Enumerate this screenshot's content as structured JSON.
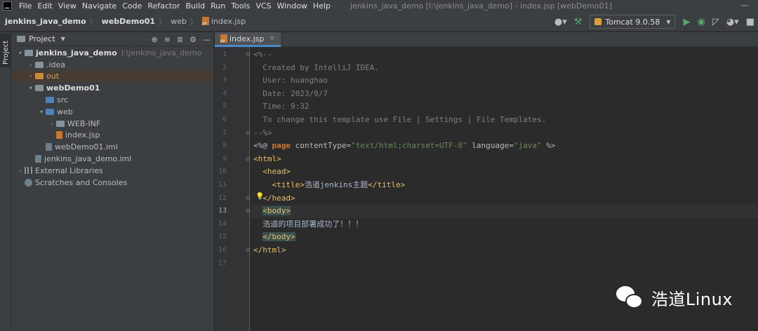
{
  "menubar": {
    "items": [
      "File",
      "Edit",
      "View",
      "Navigate",
      "Code",
      "Refactor",
      "Build",
      "Run",
      "Tools",
      "VCS",
      "Window",
      "Help"
    ],
    "window_title": "jenkins_java_demo [I:\\jenkins_java_demo] - index.jsp [webDemo01]",
    "minimize": "—"
  },
  "navbar": {
    "breadcrumbs": [
      "jenkins_java_demo",
      "webDemo01",
      "web",
      "index.jsp"
    ],
    "run_config": "Tomcat 9.0.58"
  },
  "left_stripe": {
    "label": "Project"
  },
  "project_panel": {
    "title": "Project",
    "tree": [
      {
        "label": "jenkins_java_demo",
        "hint": "I:\\jenkins_java_demo",
        "depth": 0,
        "arrow": "▾",
        "icon": "folder-grey",
        "style": "bold"
      },
      {
        "label": ".idea",
        "depth": 1,
        "arrow": "›",
        "icon": "folder-grey"
      },
      {
        "label": "out",
        "depth": 1,
        "arrow": "›",
        "icon": "folder-orange",
        "style": "orange",
        "selected": true
      },
      {
        "label": "webDemo01",
        "depth": 1,
        "arrow": "▾",
        "icon": "folder-grey",
        "style": "bold"
      },
      {
        "label": "src",
        "depth": 2,
        "arrow": "",
        "icon": "folder-blue"
      },
      {
        "label": "web",
        "depth": 2,
        "arrow": "▾",
        "icon": "folder-blue"
      },
      {
        "label": "WEB-INF",
        "depth": 3,
        "arrow": "›",
        "icon": "folder-grey"
      },
      {
        "label": "index.jsp",
        "depth": 3,
        "arrow": "",
        "icon": "file-jsp"
      },
      {
        "label": "webDemo01.iml",
        "depth": 2,
        "arrow": "",
        "icon": "file"
      },
      {
        "label": "jenkins_java_demo.iml",
        "depth": 1,
        "arrow": "",
        "icon": "file"
      },
      {
        "label": "External Libraries",
        "depth": 0,
        "arrow": "›",
        "icon": "library"
      },
      {
        "label": "Scratches and Consoles",
        "depth": 0,
        "arrow": "",
        "icon": "scratch"
      }
    ]
  },
  "editor": {
    "tab_label": "index.jsp",
    "current_line": 13,
    "lines": [
      {
        "n": "1",
        "segs": [
          [
            "c-comment",
            "<%--"
          ]
        ]
      },
      {
        "n": "2",
        "segs": [
          [
            "c-comment",
            "  Created by IntelliJ IDEA."
          ]
        ]
      },
      {
        "n": "3",
        "segs": [
          [
            "c-comment",
            "  User: huanghao"
          ]
        ]
      },
      {
        "n": "4",
        "segs": [
          [
            "c-comment",
            "  Date: 2023/9/7"
          ]
        ]
      },
      {
        "n": "5",
        "segs": [
          [
            "c-comment",
            "  Time: 9:32"
          ]
        ]
      },
      {
        "n": "6",
        "segs": [
          [
            "c-comment",
            "  To change this template use File | Settings | File Templates."
          ]
        ]
      },
      {
        "n": "7",
        "segs": [
          [
            "c-comment",
            "--%>"
          ]
        ]
      },
      {
        "n": "8",
        "segs": [
          [
            "c-text",
            "<%@ "
          ],
          [
            "c-kw",
            "page "
          ],
          [
            "c-attr",
            "contentType="
          ],
          [
            "c-str",
            "\"text/html;charset=UTF-8\""
          ],
          [
            "c-attr",
            " language="
          ],
          [
            "c-str",
            "\"java\""
          ],
          [
            "c-text",
            " %>"
          ]
        ]
      },
      {
        "n": "9",
        "segs": [
          [
            "c-tag",
            "<html>"
          ]
        ]
      },
      {
        "n": "10",
        "segs": [
          [
            "c-text",
            "  "
          ],
          [
            "c-tag",
            "<head>"
          ]
        ]
      },
      {
        "n": "11",
        "segs": [
          [
            "c-text",
            "    "
          ],
          [
            "c-tag",
            "<title>"
          ],
          [
            "c-text",
            "浩道jenkins主题"
          ],
          [
            "c-tag",
            "</title>"
          ]
        ]
      },
      {
        "n": "12",
        "segs": [
          [
            "c-text",
            "  "
          ],
          [
            "c-tag",
            "</head>"
          ]
        ]
      },
      {
        "n": "13",
        "segs": [
          [
            "c-text",
            "  "
          ],
          [
            "c-tag tag-hl",
            "<body>"
          ]
        ]
      },
      {
        "n": "14",
        "segs": [
          [
            "c-text",
            "  浩道的项目部署成功了！！！"
          ]
        ]
      },
      {
        "n": "15",
        "segs": [
          [
            "c-text",
            "  "
          ],
          [
            "c-tag tag-hl",
            "</body>"
          ]
        ]
      },
      {
        "n": "16",
        "segs": [
          [
            "c-tag",
            "</html>"
          ]
        ]
      },
      {
        "n": "17",
        "segs": []
      }
    ]
  },
  "watermark": {
    "text": "浩道Linux"
  }
}
